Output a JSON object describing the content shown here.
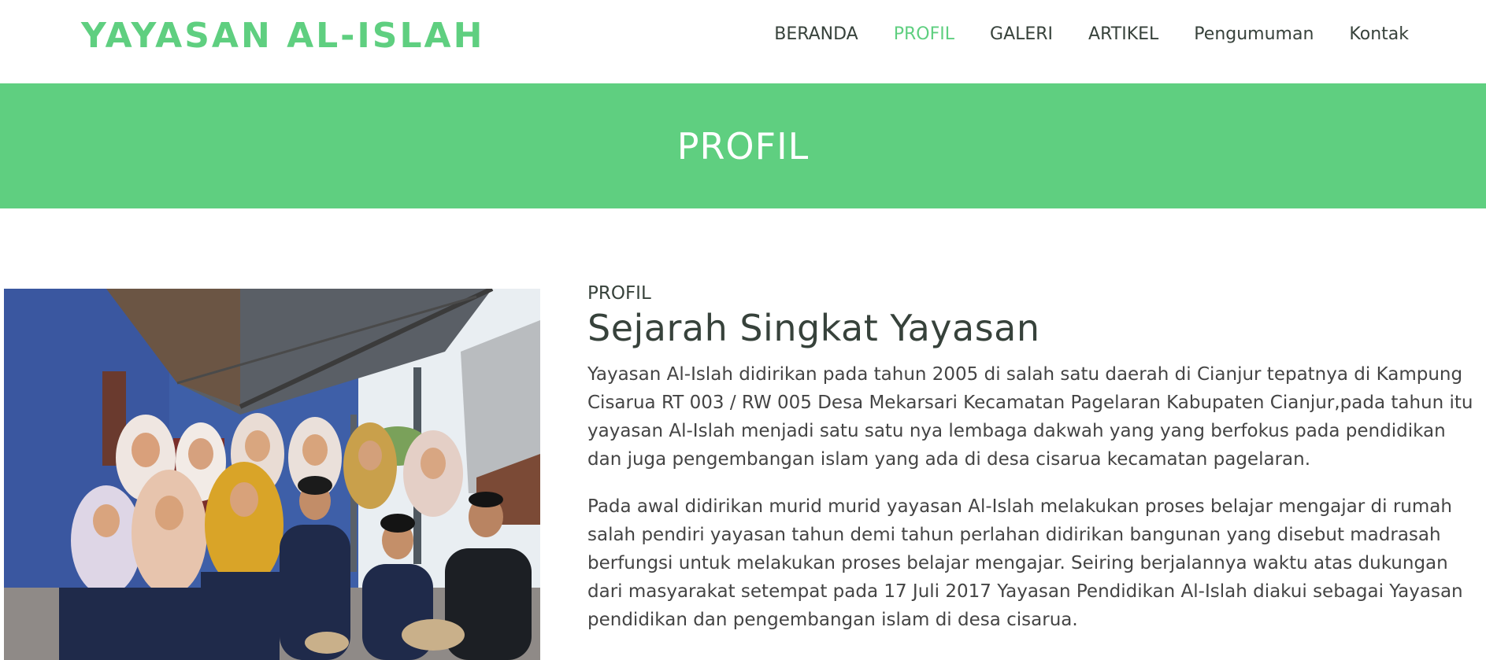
{
  "header": {
    "logo": "YAYASAN AL-ISLAH",
    "nav": [
      {
        "label": "BERANDA",
        "active": false
      },
      {
        "label": "PROFIL",
        "active": true
      },
      {
        "label": "GALERI",
        "active": false
      },
      {
        "label": "ARTIKEL",
        "active": false
      },
      {
        "label": "Pengumuman",
        "active": false
      },
      {
        "label": "Kontak",
        "active": false
      }
    ]
  },
  "banner": {
    "title": "PROFIL"
  },
  "content": {
    "label": "PROFIL",
    "title": "Sejarah Singkat Yayasan",
    "paragraphs": [
      "Yayasan Al-Islah didirikan pada tahun 2005 di salah satu daerah di Cianjur tepatnya di Kampung Cisarua RT 003 / RW 005 Desa Mekarsari Kecamatan Pagelaran Kabupaten Cianjur,pada tahun itu yayasan Al-Islah menjadi satu satu nya lembaga dakwah yang yang berfokus pada pendidikan dan juga pengembangan islam yang ada di desa cisarua kecamatan pagelaran.",
      "Pada awal didirikan murid murid yayasan Al-Islah melakukan proses belajar mengajar di rumah salah pendiri yayasan tahun demi tahun perlahan didirikan bangunan yang disebut madrasah berfungsi untuk melakukan proses belajar mengajar. Seiring berjalannya waktu atas dukungan dari masyarakat setempat pada 17 Juli 2017 Yayasan Pendidikan Al-Islah diakui sebagai Yayasan pendidikan dan pengembangan islam di desa cisarua."
    ]
  },
  "colors": {
    "accent": "#5fcf80",
    "heading": "#37423b",
    "body_text": "#444444"
  }
}
